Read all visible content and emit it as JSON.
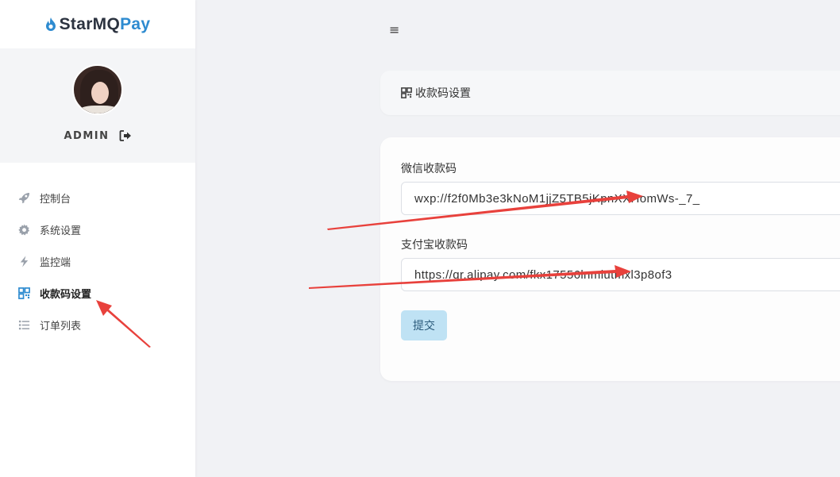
{
  "brand": {
    "part1": "StarMQ",
    "part2": "Pay"
  },
  "user": {
    "name": "ADMIN"
  },
  "sidebar": {
    "items": [
      {
        "label": "控制台",
        "icon": "rocket-icon"
      },
      {
        "label": "系统设置",
        "icon": "gear-icon"
      },
      {
        "label": "监控端",
        "icon": "bolt-icon"
      },
      {
        "label": "收款码设置",
        "icon": "qrcode-icon",
        "active": true
      },
      {
        "label": "订单列表",
        "icon": "list-icon"
      }
    ]
  },
  "header": {
    "menu_toggle": "≡"
  },
  "breadcrumb": {
    "label": "收款码设置",
    "icon": "qrcode-icon"
  },
  "form": {
    "wechat_label": "微信收款码",
    "wechat_value": "wxp://f2f0Mb3e3kNoM1jjZ5TB5jKpnXXHomWs-_7_",
    "alipay_label": "支付宝收款码",
    "alipay_value": "https://qr.alipay.com/fkx17556lnmiutmxl3p8of3",
    "submit_label": "提交"
  },
  "colors": {
    "brand_dark": "#2c3340",
    "brand_accent": "#2e8bd0",
    "active_icon": "#2e8bd0",
    "submit_bg": "#bfe2f4",
    "annotation_arrow": "#e8413c"
  }
}
